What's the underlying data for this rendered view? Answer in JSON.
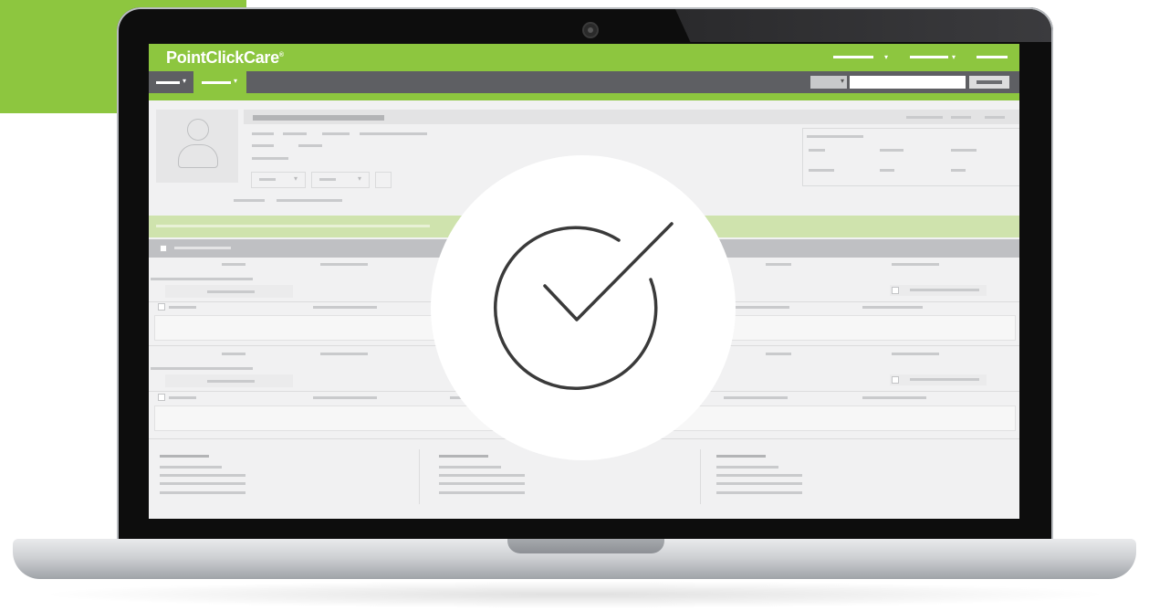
{
  "app": {
    "logo_text": "PointClickCare",
    "logo_mark": "®",
    "brand_color": "#8dc63f",
    "nav_color": "#5e5f63"
  },
  "overlay": {
    "icon": "checkmark-circle-icon"
  }
}
